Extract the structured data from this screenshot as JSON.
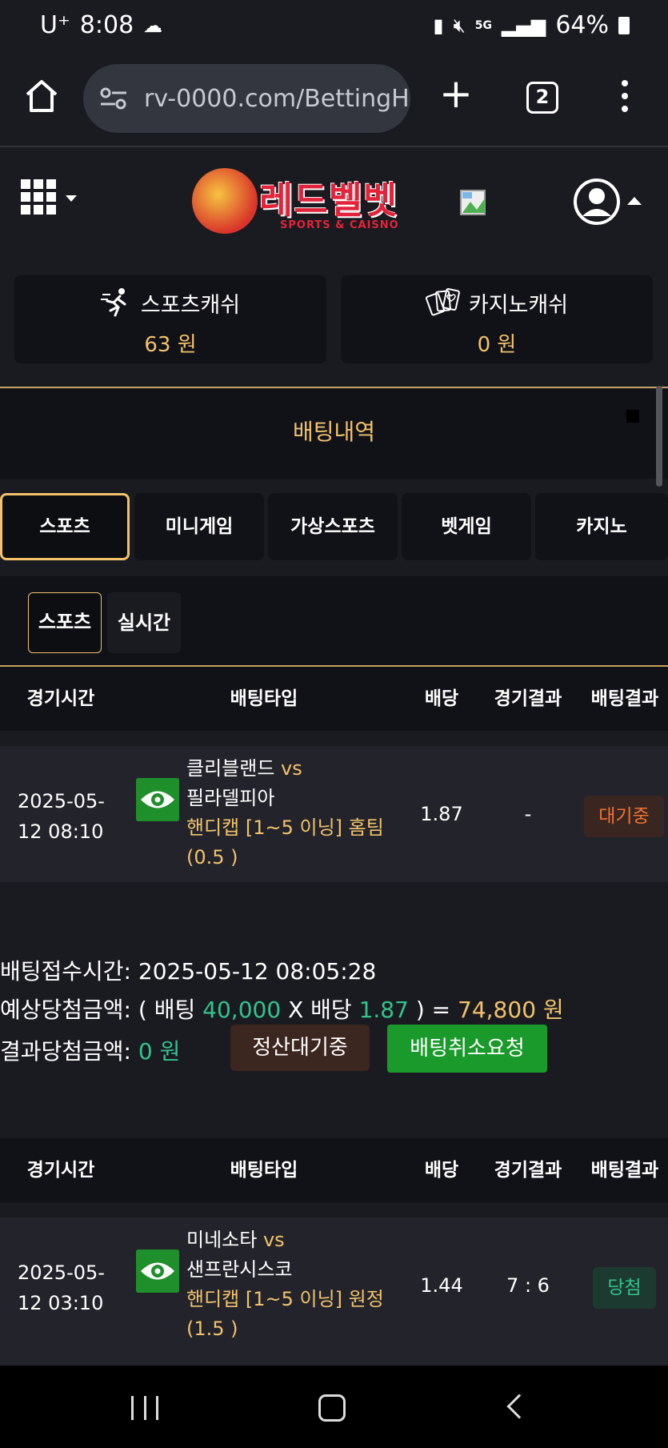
{
  "status_bar": {
    "carrier": "U⁺",
    "time": "8:08",
    "network": "5G",
    "battery": "64%"
  },
  "browser": {
    "url": "rv-0000.com/BettingH",
    "tab_count": "2",
    "new_tab": "+"
  },
  "header": {
    "brand": "레드벨벳",
    "brand_sub": "SPORTS & CAISNO"
  },
  "wallet": {
    "sports_label": "스포츠캐쉬",
    "sports_amount": "63 원",
    "casino_label": "카지노캐쉬",
    "casino_amount": "0 원"
  },
  "page_title": "배팅내역",
  "category_tabs": [
    "스포츠",
    "미니게임",
    "가상스포츠",
    "벳게임",
    "카지노"
  ],
  "sub_tabs": [
    "스포츠",
    "실시간"
  ],
  "table_headers": [
    "경기시간",
    "배팅타입",
    "배당",
    "경기결과",
    "배팅결과"
  ],
  "bets": [
    {
      "time_line1": "2025-05-",
      "time_line2": "12 08:10",
      "home": "클리블랜드",
      "vs": "vs",
      "away": "필라델피아",
      "bet_type_line1": "핸디캡 [1~5 이닝] 홈팀",
      "bet_type_line2": "(0.5 )",
      "odds": "1.87",
      "game_result": "-",
      "bet_result": "대기중"
    },
    {
      "time_line1": "2025-05-",
      "time_line2": "12 03:10",
      "home": "미네소타",
      "vs": "vs",
      "away": "샌프란시스코",
      "bet_type_line1": "핸디캡 [1~5 이닝] 원정",
      "bet_type_line2": "(1.5 )",
      "odds": "1.44",
      "game_result": "7 : 6",
      "bet_result": "당첨"
    }
  ],
  "detail": {
    "accept_label": "배팅접수시간:",
    "accept_time": "2025-05-12 08:05:28",
    "expected_label": "예상당첨금액:",
    "open_paren": "( 배팅",
    "stake": "40,000",
    "times": "X 배당",
    "odds": "1.87",
    "close_eq": ") =",
    "expected_amount": "74,800 원",
    "result_label": "결과당첨금액:",
    "result_amount": "0 원",
    "pending_button": "정산대기중",
    "cancel_button": "배팅취소요청"
  },
  "colors": {
    "background": "#1a1b21",
    "panel": "#111217",
    "accent_gold": "#f3c26b",
    "green": "#31c48d",
    "button_green": "#1a9a2b",
    "wait_orange": "#f07230"
  }
}
